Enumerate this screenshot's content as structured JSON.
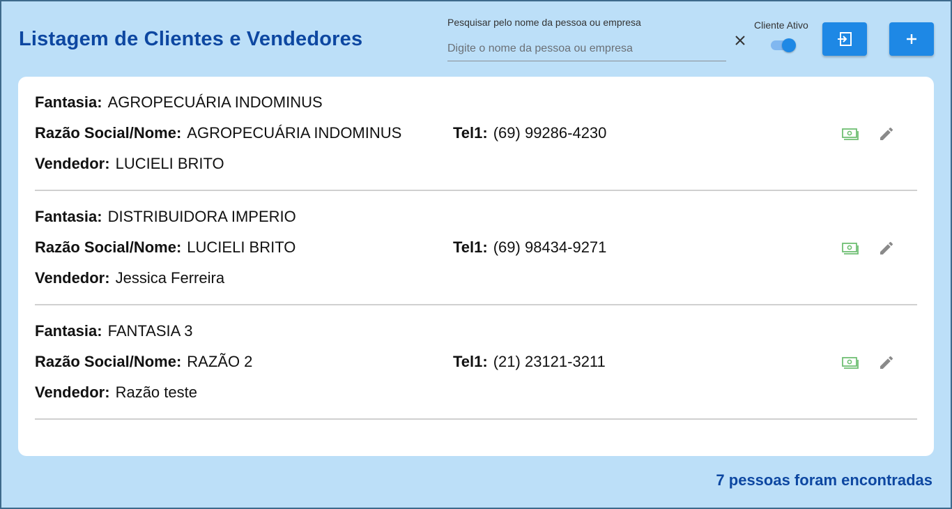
{
  "header": {
    "title": "Listagem de Clientes e Vendedores",
    "search_label": "Pesquisar pelo nome da pessoa ou empresa",
    "search_placeholder": "Digite o nome da pessoa ou empresa",
    "search_value": "",
    "toggle_label": "Cliente Ativo",
    "toggle_on": true
  },
  "field_labels": {
    "fantasia": "Fantasia:",
    "razao": "Razão Social/Nome:",
    "tel": "Tel1:",
    "vendedor": "Vendedor:"
  },
  "clients": [
    {
      "fantasia": "AGROPECUÁRIA INDOMINUS",
      "razao": "AGROPECUÁRIA INDOMINUS",
      "tel": "(69) 99286-4230",
      "vendedor": "LUCIELI BRITO"
    },
    {
      "fantasia": "DISTRIBUIDORA IMPERIO",
      "razao": "LUCIELI BRITO",
      "tel": "(69) 98434-9271",
      "vendedor": "Jessica Ferreira"
    },
    {
      "fantasia": "FANTASIA 3",
      "razao": "RAZÃO 2",
      "tel": "(21) 23121-3211",
      "vendedor": "Razão teste"
    }
  ],
  "icons": {
    "clear": "close-icon",
    "export": "export-icon",
    "add": "plus-icon",
    "money": "money-icon",
    "edit": "pencil-icon"
  },
  "colors": {
    "background": "#bcdff8",
    "primary": "#1e88e5",
    "title": "#0d47a1",
    "money_icon": "#6fbf73",
    "edit_icon": "#8a8a8a"
  },
  "footer": {
    "count_text": "7 pessoas foram encontradas"
  }
}
